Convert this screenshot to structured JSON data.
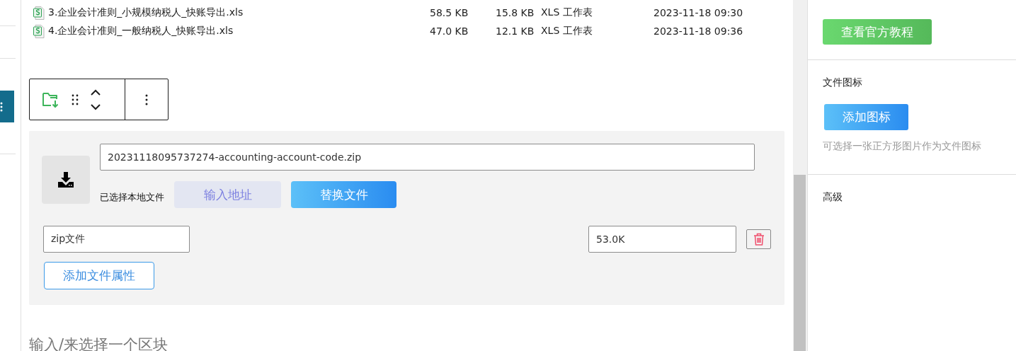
{
  "files": [
    {
      "name": "3.企业会计准则_小规模纳税人_快账导出.xls",
      "size": "58.5 KB",
      "compressed": "15.8 KB",
      "type": "XLS 工作表",
      "modified": "2023-11-18 09:30"
    },
    {
      "name": "4.企业会计准则_一般纳税人_快账导出.xls",
      "size": "47.0 KB",
      "compressed": "12.1 KB",
      "type": "XLS 工作表",
      "modified": "2023-11-18 09:36"
    }
  ],
  "file_block": {
    "file_url": "20231118095737274-accounting-account-code.zip",
    "source_label": "已选择本地文件",
    "buttons": [
      {
        "label": "输入地址",
        "kind": "secondary"
      },
      {
        "label": "替换文件",
        "kind": "primary"
      }
    ],
    "attributes": [
      {
        "name": "zip文件",
        "value": "53.0K"
      }
    ],
    "add_attribute_button": "添加文件属性"
  },
  "block_placeholder": "输入/来选择一个区块",
  "sidebar": {
    "tutorial_button": "查看官方教程",
    "sections": [
      {
        "title": "文件图标",
        "button": "添加图标",
        "hint": "可选择一张正方形图片作为文件图标"
      },
      {
        "title": "高级"
      }
    ]
  }
}
